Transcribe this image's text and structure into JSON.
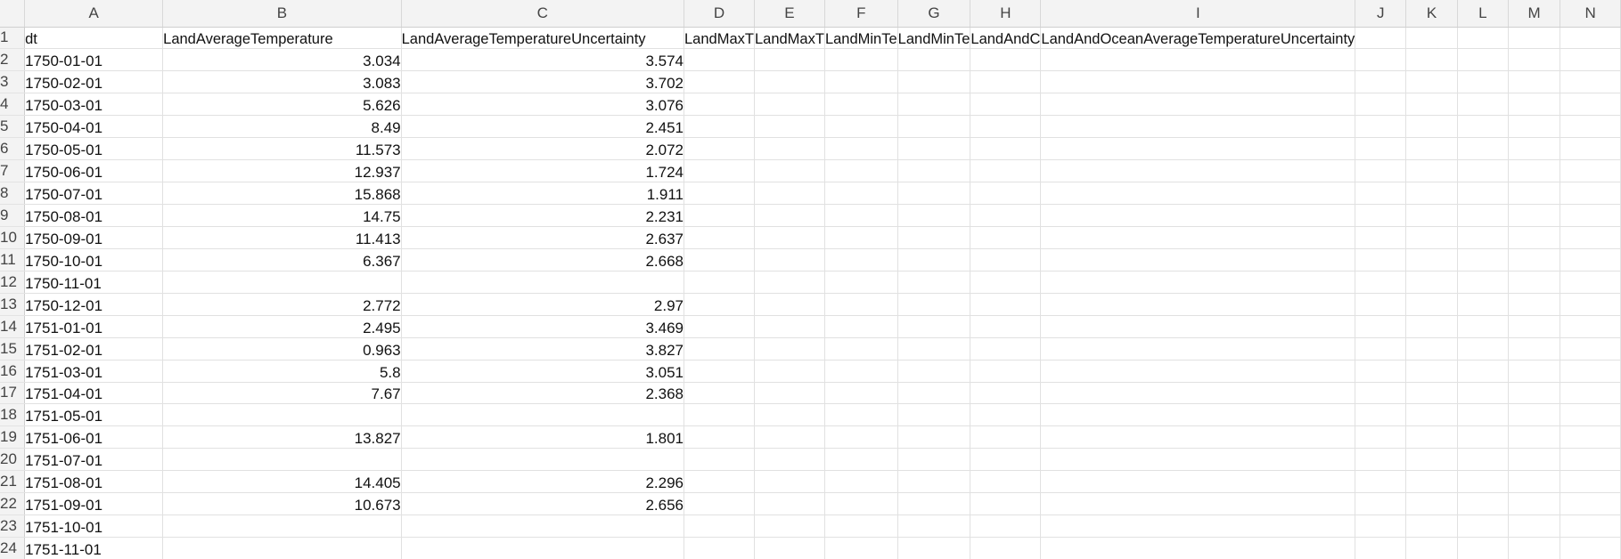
{
  "columns": [
    "A",
    "B",
    "C",
    "D",
    "E",
    "F",
    "G",
    "H",
    "I",
    "J",
    "K",
    "L",
    "M",
    "N"
  ],
  "header_row": {
    "row_number": "1",
    "cells": {
      "A": "dt",
      "B": "LandAverageTemperature",
      "C": "LandAverageTemperatureUncertainty",
      "D": "LandMaxT",
      "E": "LandMaxT",
      "F": "LandMinTe",
      "G": "LandMinTe",
      "H": "LandAndC",
      "I": "LandAndOceanAverageTemperatureUncertainty"
    }
  },
  "rows": [
    {
      "n": "2",
      "dt": "1750-01-01",
      "avg": "3.034",
      "unc": "3.574"
    },
    {
      "n": "3",
      "dt": "1750-02-01",
      "avg": "3.083",
      "unc": "3.702"
    },
    {
      "n": "4",
      "dt": "1750-03-01",
      "avg": "5.626",
      "unc": "3.076"
    },
    {
      "n": "5",
      "dt": "1750-04-01",
      "avg": "8.49",
      "unc": "2.451"
    },
    {
      "n": "6",
      "dt": "1750-05-01",
      "avg": "11.573",
      "unc": "2.072"
    },
    {
      "n": "7",
      "dt": "1750-06-01",
      "avg": "12.937",
      "unc": "1.724"
    },
    {
      "n": "8",
      "dt": "1750-07-01",
      "avg": "15.868",
      "unc": "1.911"
    },
    {
      "n": "9",
      "dt": "1750-08-01",
      "avg": "14.75",
      "unc": "2.231"
    },
    {
      "n": "10",
      "dt": "1750-09-01",
      "avg": "11.413",
      "unc": "2.637"
    },
    {
      "n": "11",
      "dt": "1750-10-01",
      "avg": "6.367",
      "unc": "2.668"
    },
    {
      "n": "12",
      "dt": "1750-11-01",
      "avg": "",
      "unc": ""
    },
    {
      "n": "13",
      "dt": "1750-12-01",
      "avg": "2.772",
      "unc": "2.97"
    },
    {
      "n": "14",
      "dt": "1751-01-01",
      "avg": "2.495",
      "unc": "3.469"
    },
    {
      "n": "15",
      "dt": "1751-02-01",
      "avg": "0.963",
      "unc": "3.827"
    },
    {
      "n": "16",
      "dt": "1751-03-01",
      "avg": "5.8",
      "unc": "3.051"
    },
    {
      "n": "17",
      "dt": "1751-04-01",
      "avg": "7.67",
      "unc": "2.368"
    },
    {
      "n": "18",
      "dt": "1751-05-01",
      "avg": "",
      "unc": ""
    },
    {
      "n": "19",
      "dt": "1751-06-01",
      "avg": "13.827",
      "unc": "1.801"
    },
    {
      "n": "20",
      "dt": "1751-07-01",
      "avg": "",
      "unc": ""
    },
    {
      "n": "21",
      "dt": "1751-08-01",
      "avg": "14.405",
      "unc": "2.296"
    },
    {
      "n": "22",
      "dt": "1751-09-01",
      "avg": "10.673",
      "unc": "2.656"
    },
    {
      "n": "23",
      "dt": "1751-10-01",
      "avg": "",
      "unc": ""
    },
    {
      "n": "24",
      "dt": "1751-11-01",
      "avg": "",
      "unc": ""
    }
  ]
}
